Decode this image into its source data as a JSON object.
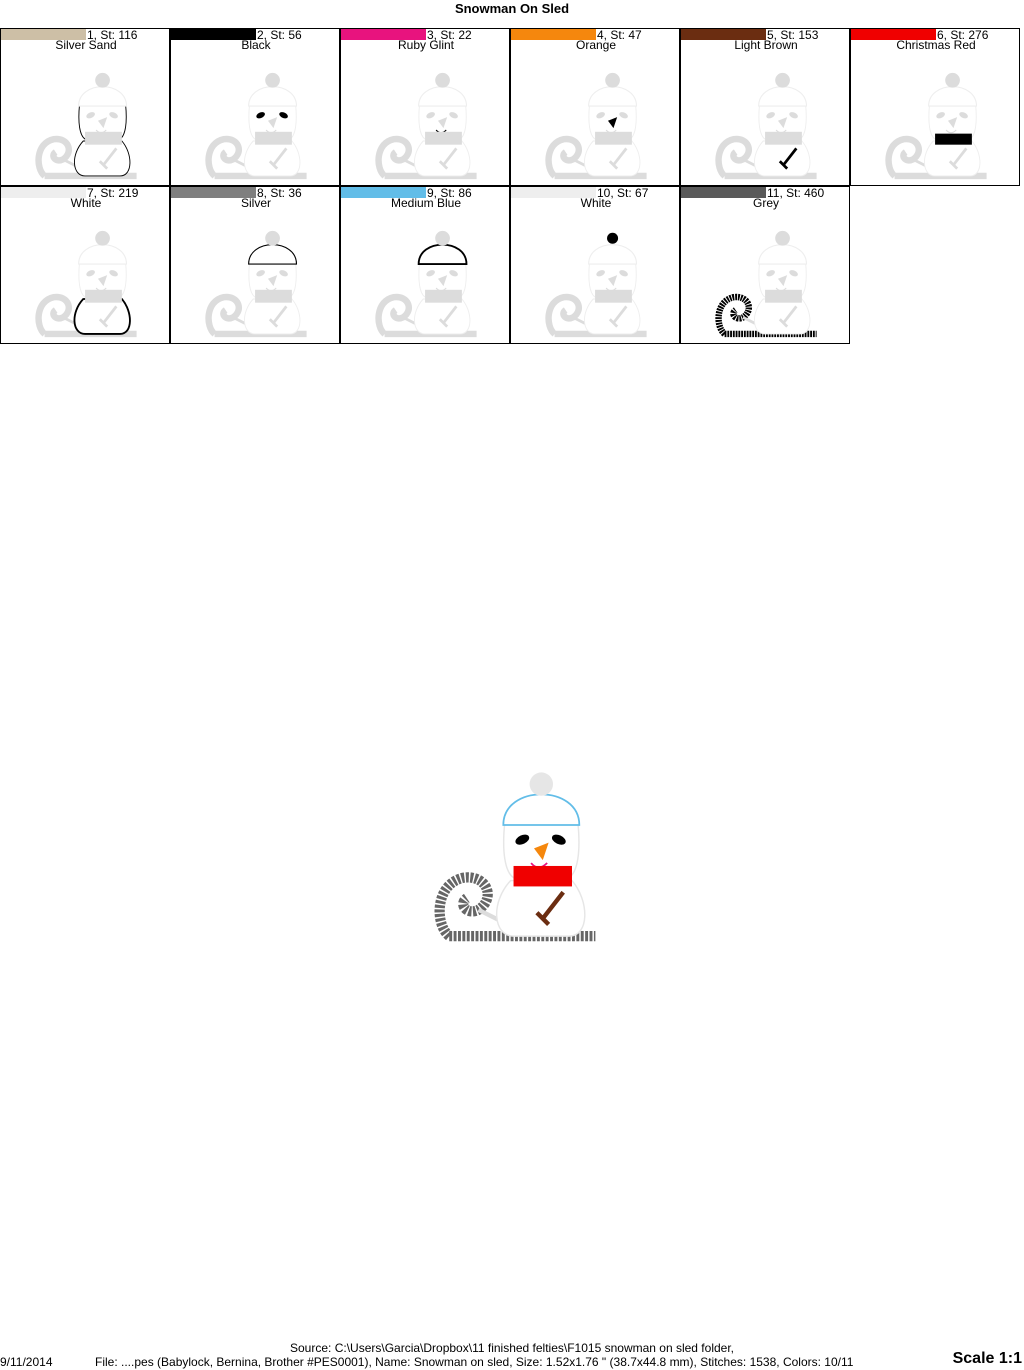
{
  "title": "Snowman On Sled",
  "colors": [
    {
      "label": "1, St: 116",
      "name": "Silver Sand",
      "hex": "#cdbfa6",
      "part": "outline"
    },
    {
      "label": "2, St: 56",
      "name": "Black",
      "hex": "#000000",
      "part": "eyes"
    },
    {
      "label": "3, St: 22",
      "name": "Ruby Glint",
      "hex": "#e8137e",
      "part": "mouth"
    },
    {
      "label": "4, St: 47",
      "name": "Orange",
      "hex": "#f5870d",
      "part": "nose"
    },
    {
      "label": "5, St: 153",
      "name": "Light Brown",
      "hex": "#6b2d11",
      "part": "arm"
    },
    {
      "label": "6, St: 276",
      "name": "Christmas Red",
      "hex": "#f00000",
      "part": "scarf"
    },
    {
      "label": "7, St: 219",
      "name": "White",
      "hex": "#eeeeee",
      "part": "body"
    },
    {
      "label": "8, St: 36",
      "name": "Silver",
      "hex": "#7f7f7f",
      "part": "hat"
    },
    {
      "label": "9, St: 86",
      "name": "Medium Blue",
      "hex": "#62bde8",
      "part": "hat-thick"
    },
    {
      "label": "10, St: 67",
      "name": "White",
      "hex": "#eeeeee",
      "part": "pom"
    },
    {
      "label": "11, St: 460",
      "name": "Grey",
      "hex": "#5a5a5a",
      "part": "sled"
    }
  ],
  "footer": {
    "source": "Source: C:\\Users\\Garcia\\Dropbox\\11 finished felties\\F1015 snowman on sled folder,",
    "date": "9/11/2014",
    "file": "File: ....pes (Babylock, Bernina, Brother #PES0001), Name: Snowman on sled, Size: 1.52x1.76 \" (38.7x44.8 mm), Stitches: 1538, Colors: 10/11",
    "scale": "Scale 1:1"
  }
}
